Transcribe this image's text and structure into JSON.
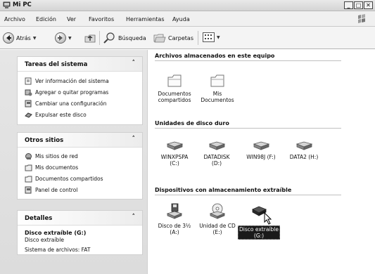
{
  "window": {
    "title": "Mi PC",
    "buttons": [
      "_",
      "□",
      "✕"
    ]
  },
  "menu": [
    "Archivo",
    "Edición",
    "Ver",
    "Favoritos",
    "Herramientas",
    "Ayuda"
  ],
  "toolbar": {
    "back_label": "Atrás",
    "search_label": "Búsqueda",
    "folders_label": "Carpetas"
  },
  "sidebar": {
    "system_tasks": {
      "title": "Tareas del sistema",
      "items": [
        {
          "label": "Ver información del sistema",
          "icon": "system-info-icon"
        },
        {
          "label": "Agregar o quitar programas",
          "icon": "add-remove-programs-icon"
        },
        {
          "label": "Cambiar una configuración",
          "icon": "control-panel-icon"
        },
        {
          "label": "Expulsar este disco",
          "icon": "eject-disk-icon"
        }
      ]
    },
    "other_places": {
      "title": "Otros sitios",
      "items": [
        {
          "label": "Mis sitios de red",
          "icon": "network-places-icon"
        },
        {
          "label": "Mis documentos",
          "icon": "my-documents-icon"
        },
        {
          "label": "Documentos compartidos",
          "icon": "shared-folder-icon"
        },
        {
          "label": "Panel de control",
          "icon": "control-panel-icon"
        }
      ]
    },
    "details": {
      "title": "Detalles",
      "name": "Disco extraíble (G:)",
      "type": "Disco extraíble",
      "filesystem": "Sistema de archivos: FAT"
    }
  },
  "main": {
    "stored_files": {
      "title": "Archivos almacenados en este equipo",
      "items": [
        {
          "line1": "Documentos",
          "line2": "compartidos"
        },
        {
          "line1": "Mis",
          "line2": "Documentos"
        }
      ]
    },
    "hard_drives": {
      "title": "Unidades de disco duro",
      "items": [
        {
          "line1": "WINXPSPA",
          "line2": "(C:)"
        },
        {
          "line1": "DATADISK",
          "line2": "(D:)"
        },
        {
          "line1": "WIN98J (F:)",
          "line2": ""
        },
        {
          "line1": "DATA2 (H:)",
          "line2": ""
        }
      ]
    },
    "removable": {
      "title": "Dispositivos con almacenamiento extraíble",
      "items": [
        {
          "line1": "Disco de 3½",
          "line2": "(A:)"
        },
        {
          "line1": "Unidad de CD",
          "line2": "(E:)"
        },
        {
          "line1": "Disco extraíble",
          "line2": "(G:)",
          "selected": true
        }
      ]
    }
  }
}
